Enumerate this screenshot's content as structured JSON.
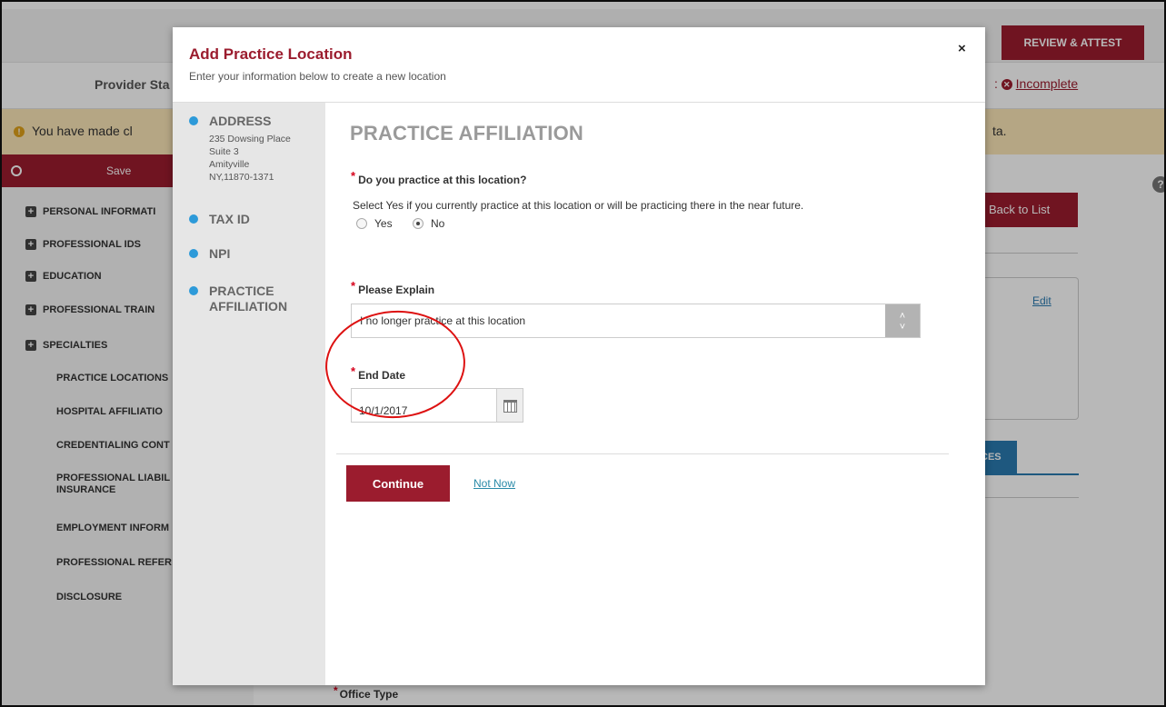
{
  "app": {
    "review_button": "REVIEW & ATTEST",
    "provider_status": "Provider Sta",
    "status_tail": ":",
    "incomplete": "Incomplete",
    "warning_text": "You have made cl",
    "warning_tail": "ta.",
    "help": "?",
    "back_button": "Back to List",
    "edit_link": "Edit",
    "tab_label": "CES",
    "office_type": "Office Type"
  },
  "sidebar": {
    "save_label": "Save",
    "items": [
      {
        "label": "PERSONAL INFORMATI",
        "plus": "+"
      },
      {
        "label": "PROFESSIONAL IDS",
        "plus": "+"
      },
      {
        "label": "EDUCATION",
        "plus": "+"
      },
      {
        "label": "PROFESSIONAL TRAIN",
        "plus": "+"
      },
      {
        "label": "SPECIALTIES",
        "plus": "+"
      },
      {
        "label": "PRACTICE LOCATIONS"
      },
      {
        "label": "HOSPITAL AFFILIATIO"
      },
      {
        "label": "CREDENTIALING CONT"
      },
      {
        "label": "PROFESSIONAL LIABIL INSURANCE"
      },
      {
        "label": "EMPLOYMENT INFORM"
      },
      {
        "label": "PROFESSIONAL REFER"
      },
      {
        "label": "DISCLOSURE"
      }
    ]
  },
  "modal": {
    "title": "Add Practice Location",
    "subtitle": "Enter your information below to create a new location",
    "close": "×",
    "steps": [
      {
        "name": "ADDRESS",
        "address_lines": [
          "235 Dowsing Place",
          "Suite 3",
          "Amityville",
          "NY,11870-1371"
        ]
      },
      {
        "name": "TAX ID"
      },
      {
        "name": "NPI"
      },
      {
        "name": "PRACTICE",
        "name2": "AFFILIATION"
      }
    ],
    "section_title": "PRACTICE AFFILIATION",
    "question": "Do you practice at this location?",
    "question_help": "Select Yes if you currently practice at this location or will be practicing there in the near future.",
    "radio_yes": "Yes",
    "radio_no": "No",
    "radio_selected": "No",
    "explain_label": "Please Explain",
    "explain_value": "I no longer practice at this location",
    "end_date_label": "End Date",
    "end_date_value": "10/1/2017",
    "continue_button": "Continue",
    "not_now_link": "Not Now",
    "required_mark": "*"
  },
  "colors": {
    "brand": "#9b1c2e",
    "step_dot": "#2d9ad9",
    "annotation": "#d11111"
  }
}
